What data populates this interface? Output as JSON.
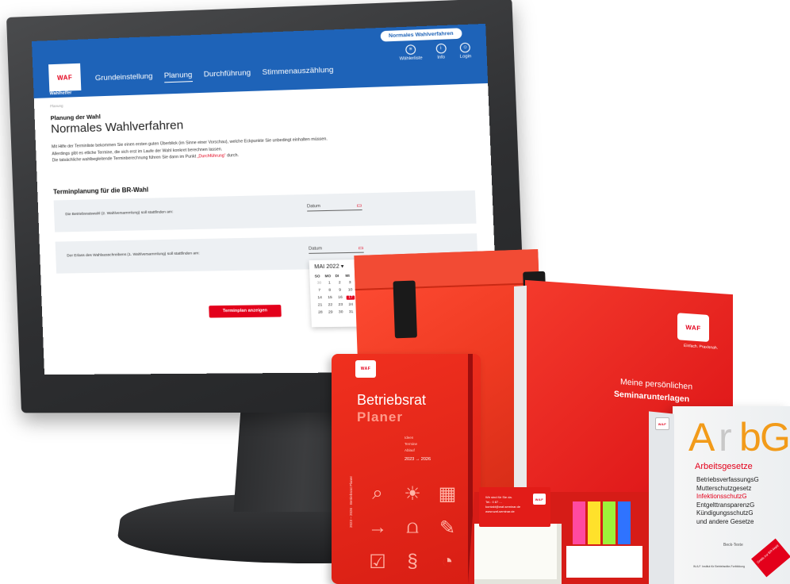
{
  "app": {
    "logo_text": "WAF",
    "logo_caption": "Wahlhelfer",
    "mode_pill": "Normales Wahlverfahren"
  },
  "top_icons": [
    {
      "icon": "list-icon",
      "label": "Wählerliste"
    },
    {
      "icon": "info-icon",
      "label": "Info"
    },
    {
      "icon": "user-icon",
      "label": "Login"
    }
  ],
  "nav": [
    {
      "label": "Grundeinstellung",
      "active": false
    },
    {
      "label": "Planung",
      "active": true
    },
    {
      "label": "Durchführung",
      "active": false
    },
    {
      "label": "Stimmenauszählung",
      "active": false
    }
  ],
  "page": {
    "breadcrumb": "Planung",
    "heading_small": "Planung der Wahl",
    "heading_big": "Normales Wahlverfahren",
    "intro_1": "Mit Hilfe der Terminliste bekommen Sie einen ersten guten Überblick (im Sinne einer Vorschau), welche Eckpunkte Sie unbedingt einhalten müssen.",
    "intro_2": "Allerdings gibt es etliche Termine, die sich erst im Laufe der Wahl konkret berechnen lassen.",
    "intro_3a": "Die tatsächliche wahlbegleitende Terminberechnung führen Sie dann im Punkt ",
    "intro_3_link": "„Durchführung“",
    "intro_3b": " durch.",
    "section_title": "Terminplanung für die BR-Wahl",
    "row1_label": "Die Betriebsratswahl (2. Wahlversammlung) soll stattfinden am:",
    "row1_placeholder": "Datum",
    "row2_label": "Der Erlass des Wahlausschreibens (1. Wahlversammlung) soll stattfinden am:",
    "row2_placeholder": "Datum",
    "cta_label": "Terminplan anzeigen"
  },
  "datepicker": {
    "month": "MAI 2022",
    "dropdown_glyph": "▾",
    "weekdays": [
      "SO",
      "MO",
      "DI",
      "MI",
      "DO",
      "FR",
      "SA"
    ],
    "days": [
      [
        "30",
        "1",
        "2",
        "3",
        "4",
        "5",
        "6"
      ],
      [
        "7",
        "8",
        "9",
        "10",
        "11",
        "12",
        "13"
      ],
      [
        "14",
        "15",
        "16",
        "17",
        "18",
        "19",
        "20"
      ],
      [
        "21",
        "22",
        "23",
        "24",
        "25",
        "26",
        "27"
      ],
      [
        "28",
        "29",
        "30",
        "31",
        "",
        "",
        ""
      ]
    ],
    "selected": "17"
  },
  "merch": {
    "folder_tag": "Einfach. Praxisnah.",
    "folder_title_1": "Meine persönlichen",
    "folder_title_2": "Seminarunterlagen",
    "planner_title_1": "Betriebsrat",
    "planner_title_2": "Planer",
    "planner_sub": "Ideen\nTermine\nAblauf",
    "planner_years": "2023 → 2026",
    "planner_spine": "2023 – 2026 · Betriebsrat Planer",
    "sticky_lid_text": "Wir sind für Sie da.\nTel.: 0 87 ...\nkontakt@waf-seminar.de\nwww.waf-seminar.de",
    "lawbook_title": "Arbeitsgesetze",
    "lawbook_big": [
      "A",
      "r",
      "b",
      "G"
    ],
    "lawbook_list": [
      "BetriebsverfassungsG",
      "Mutterschutzgesetz",
      "InfektionsschutzG",
      "EntgelttransparenzG",
      "KündigungsschutzG",
      "und andere Gesetze"
    ],
    "lawbook_publisher": "Beck-Texte",
    "lawbook_badge": "Gratis zur BR-Wahl",
    "lawbook_foot": "W.A.F. Institut für Betriebsräte-Fortbildung"
  },
  "colors": {
    "brand_blue": "#1e63b8",
    "brand_red": "#e3001b"
  }
}
